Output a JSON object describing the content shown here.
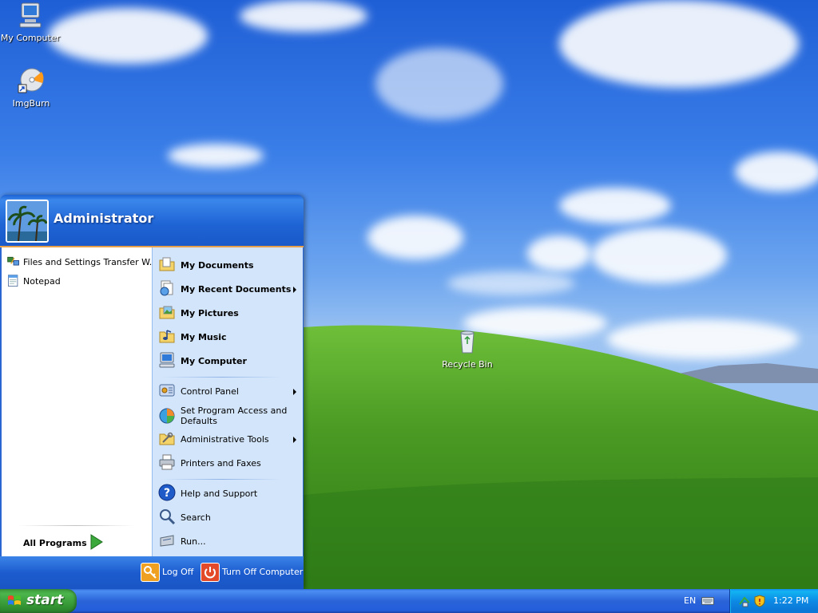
{
  "desktop": {
    "icons": [
      {
        "label": "My Computer",
        "icon": "my-computer-icon"
      },
      {
        "label": "ImgBurn",
        "icon": "imgburn-icon"
      },
      {
        "label": "Recycle Bin",
        "icon": "recycle-bin-icon"
      }
    ]
  },
  "start_menu": {
    "user_name": "Administrator",
    "left_items": [
      {
        "label": "Files and Settings Transfer W...",
        "icon": "transfer-wizard-icon"
      },
      {
        "label": "Notepad",
        "icon": "notepad-icon"
      }
    ],
    "all_programs_label": "All Programs",
    "right_items": [
      {
        "label": "My Documents",
        "icon": "folder-documents-icon",
        "bold": true
      },
      {
        "label": "My Recent Documents",
        "icon": "recent-documents-icon",
        "bold": true,
        "submenu": true
      },
      {
        "label": "My Pictures",
        "icon": "folder-pictures-icon",
        "bold": true
      },
      {
        "label": "My Music",
        "icon": "folder-music-icon",
        "bold": true
      },
      {
        "label": "My Computer",
        "icon": "my-computer-icon",
        "bold": true
      },
      {
        "label": "Control Panel",
        "icon": "control-panel-icon",
        "submenu": true
      },
      {
        "label": "Set Program Access and Defaults",
        "icon": "program-access-icon"
      },
      {
        "label": "Administrative Tools",
        "icon": "admin-tools-icon",
        "submenu": true
      },
      {
        "label": "Printers and Faxes",
        "icon": "printer-icon"
      },
      {
        "label": "Help and Support",
        "icon": "help-icon"
      },
      {
        "label": "Search",
        "icon": "search-icon"
      },
      {
        "label": "Run...",
        "icon": "run-icon"
      }
    ],
    "log_off_label": "Log Off",
    "turn_off_label": "Turn Off Computer"
  },
  "taskbar": {
    "start_label": "start",
    "language": "EN",
    "clock": "1:22 PM"
  },
  "colors": {
    "start_green": "#3c9c3c",
    "menu_blue": "#2a66d1",
    "right_pane": "#d3e5fa",
    "accent_orange": "#e8a14a"
  }
}
